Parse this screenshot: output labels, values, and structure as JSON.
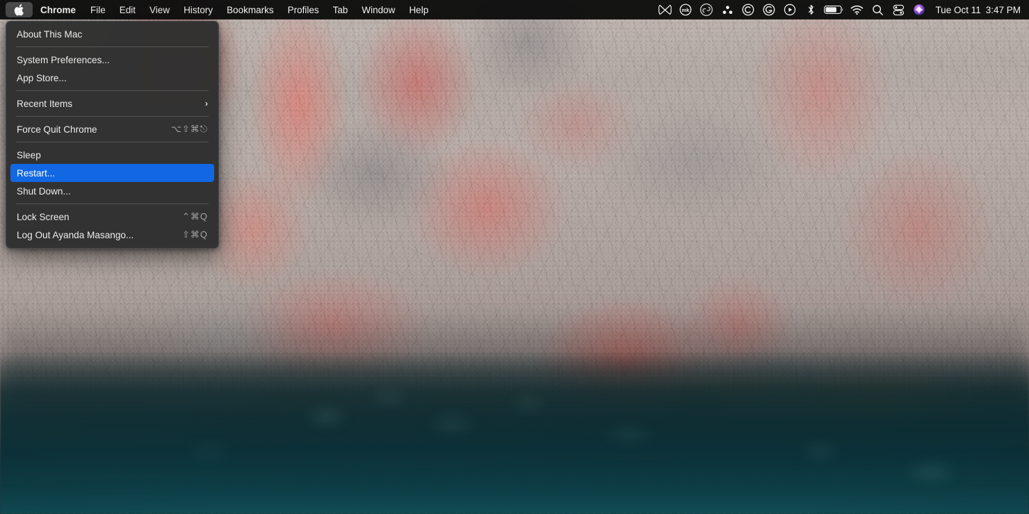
{
  "menubar": {
    "apple_icon": "apple-logo-icon",
    "items": [
      {
        "label": "Chrome",
        "bold": true
      },
      {
        "label": "File",
        "bold": false
      },
      {
        "label": "Edit",
        "bold": false
      },
      {
        "label": "View",
        "bold": false
      },
      {
        "label": "History",
        "bold": false
      },
      {
        "label": "Bookmarks",
        "bold": false
      },
      {
        "label": "Profiles",
        "bold": false
      },
      {
        "label": "Tab",
        "bold": false
      },
      {
        "label": "Window",
        "bold": false
      },
      {
        "label": "Help",
        "bold": false
      }
    ],
    "status_icons": [
      {
        "name": "butterfly-icon"
      },
      {
        "name": "mk-app-icon",
        "text": "mk"
      },
      {
        "name": "adobe-creative-cloud-icon"
      },
      {
        "name": "asana-dots-icon"
      },
      {
        "name": "copyright-c-icon"
      },
      {
        "name": "grammarly-g-icon"
      },
      {
        "name": "play-circle-icon"
      },
      {
        "name": "bluetooth-icon"
      },
      {
        "name": "battery-icon"
      },
      {
        "name": "wifi-icon"
      },
      {
        "name": "spotlight-search-icon"
      },
      {
        "name": "control-center-icon"
      },
      {
        "name": "siri-icon"
      }
    ],
    "clock": {
      "date": "Tue Oct 11",
      "time": "3:47 PM"
    }
  },
  "apple_menu": {
    "rows": [
      {
        "type": "item",
        "label": "About This Mac",
        "shortcut": "",
        "selected": false
      },
      {
        "type": "separator"
      },
      {
        "type": "item",
        "label": "System Preferences...",
        "shortcut": "",
        "selected": false
      },
      {
        "type": "item",
        "label": "App Store...",
        "shortcut": "",
        "selected": false
      },
      {
        "type": "separator"
      },
      {
        "type": "item",
        "label": "Recent Items",
        "shortcut": "",
        "selected": false,
        "submenu": "›"
      },
      {
        "type": "separator"
      },
      {
        "type": "item",
        "label": "Force Quit Chrome",
        "shortcut": "⌥⇧⌘⎋",
        "selected": false
      },
      {
        "type": "separator"
      },
      {
        "type": "item",
        "label": "Sleep",
        "shortcut": "",
        "selected": false
      },
      {
        "type": "item",
        "label": "Restart...",
        "shortcut": "",
        "selected": true
      },
      {
        "type": "item",
        "label": "Shut Down...",
        "shortcut": "",
        "selected": false
      },
      {
        "type": "separator"
      },
      {
        "type": "item",
        "label": "Lock Screen",
        "shortcut": "⌃⌘Q",
        "selected": false
      },
      {
        "type": "item",
        "label": "Log Out Ayanda Masango...",
        "shortcut": "⇧⌘Q",
        "selected": false
      }
    ]
  },
  "colors": {
    "menubar_bg": "#0a0a0a",
    "menu_bg": "#2e2e2e",
    "highlight_blue": "#1268e3",
    "text": "#ececec",
    "shortcut_text": "#a4a4a4"
  },
  "desktop": {
    "wallpaper_name": "rocky-shore-wallpaper"
  }
}
